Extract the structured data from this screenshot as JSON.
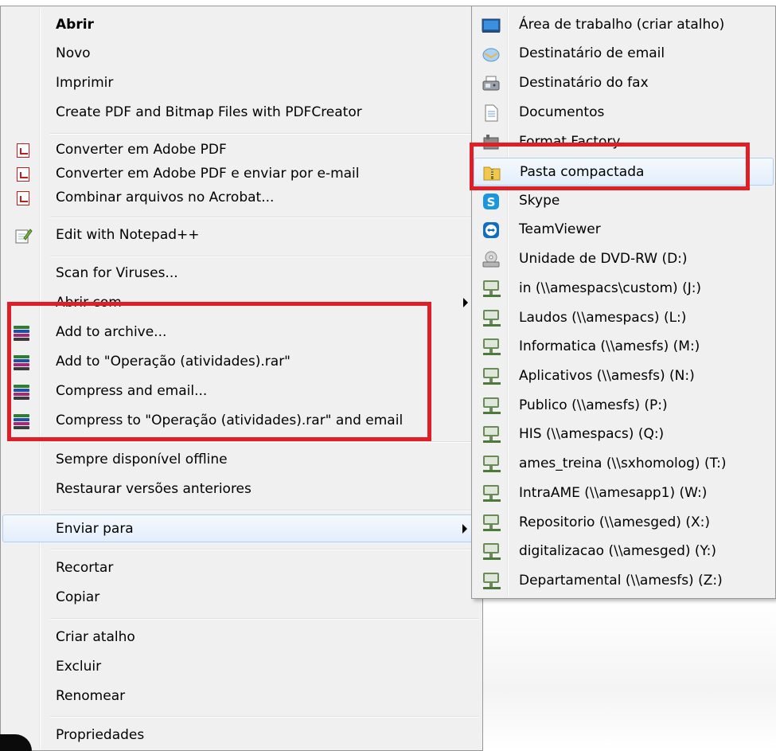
{
  "main_menu": {
    "items": [
      {
        "label": "Abrir",
        "bold": true
      },
      {
        "label": "Novo"
      },
      {
        "label": "Imprimir"
      },
      {
        "label": "Create PDF and Bitmap Files with PDFCreator"
      },
      {
        "label": "Converter em Adobe PDF",
        "icon": "pdf-icon"
      },
      {
        "label": "Converter em Adobe PDF e enviar por e-mail",
        "icon": "pdf-mail-icon"
      },
      {
        "label": "Combinar arquivos no Acrobat...",
        "icon": "acrobat-combine-icon"
      },
      {
        "label": "Edit with Notepad++",
        "icon": "notepad-icon"
      },
      {
        "label": "Scan for Viruses..."
      },
      {
        "label": "Abrir com",
        "has_submenu": true
      },
      {
        "label": "Add to archive...",
        "icon": "winrar-icon"
      },
      {
        "label": "Add to \"Operação (atividades).rar\"",
        "icon": "winrar-icon"
      },
      {
        "label": "Compress and email...",
        "icon": "winrar-icon"
      },
      {
        "label": "Compress to \"Operação (atividades).rar\" and email",
        "icon": "winrar-icon"
      },
      {
        "label": "Sempre disponível offline"
      },
      {
        "label": "Restaurar versões anteriores"
      },
      {
        "label": "Enviar para",
        "has_submenu": true,
        "highlighted": true
      },
      {
        "label": "Recortar"
      },
      {
        "label": "Copiar"
      },
      {
        "label": "Criar atalho"
      },
      {
        "label": "Excluir"
      },
      {
        "label": "Renomear"
      },
      {
        "label": "Propriedades"
      }
    ]
  },
  "send_to_menu": {
    "items": [
      {
        "label": "Área de trabalho (criar atalho)",
        "icon": "desktop-icon"
      },
      {
        "label": "Destinatário de email",
        "icon": "mail-icon"
      },
      {
        "label": "Destinatário do fax",
        "icon": "fax-icon"
      },
      {
        "label": "Documentos",
        "icon": "documents-icon"
      },
      {
        "label": "Format Factory",
        "icon": "format-factory-icon"
      },
      {
        "label": "Pasta compactada",
        "icon": "zip-folder-icon",
        "highlighted": true
      },
      {
        "label": "Skype",
        "icon": "skype-icon"
      },
      {
        "label": "TeamViewer",
        "icon": "teamviewer-icon"
      },
      {
        "label": "Unidade de DVD-RW (D:)",
        "icon": "dvd-drive-icon"
      },
      {
        "label": "in (\\\\amespacs\\custom) (J:)",
        "icon": "network-drive-icon"
      },
      {
        "label": "Laudos (\\\\amespacs) (L:)",
        "icon": "network-drive-icon"
      },
      {
        "label": "Informatica (\\\\amesfs) (M:)",
        "icon": "network-drive-icon"
      },
      {
        "label": "Aplicativos (\\\\amesfs) (N:)",
        "icon": "network-drive-icon"
      },
      {
        "label": "Publico (\\\\amesfs) (P:)",
        "icon": "network-drive-icon"
      },
      {
        "label": "HIS (\\\\amespacs) (Q:)",
        "icon": "network-drive-icon"
      },
      {
        "label": "ames_treina (\\\\sxhomolog) (T:)",
        "icon": "network-drive-icon"
      },
      {
        "label": "IntraAME (\\\\amesapp1) (W:)",
        "icon": "network-drive-icon"
      },
      {
        "label": "Repositorio (\\\\amesged) (X:)",
        "icon": "network-drive-icon"
      },
      {
        "label": "digitalizacao (\\\\amesged) (Y:)",
        "icon": "network-drive-icon"
      },
      {
        "label": "Departamental (\\\\amesfs) (Z:)",
        "icon": "network-drive-icon"
      }
    ]
  },
  "colors": {
    "highlight_box": "#e01e25",
    "menu_bg": "#f0f0f0",
    "hover_border": "#aecff7"
  }
}
